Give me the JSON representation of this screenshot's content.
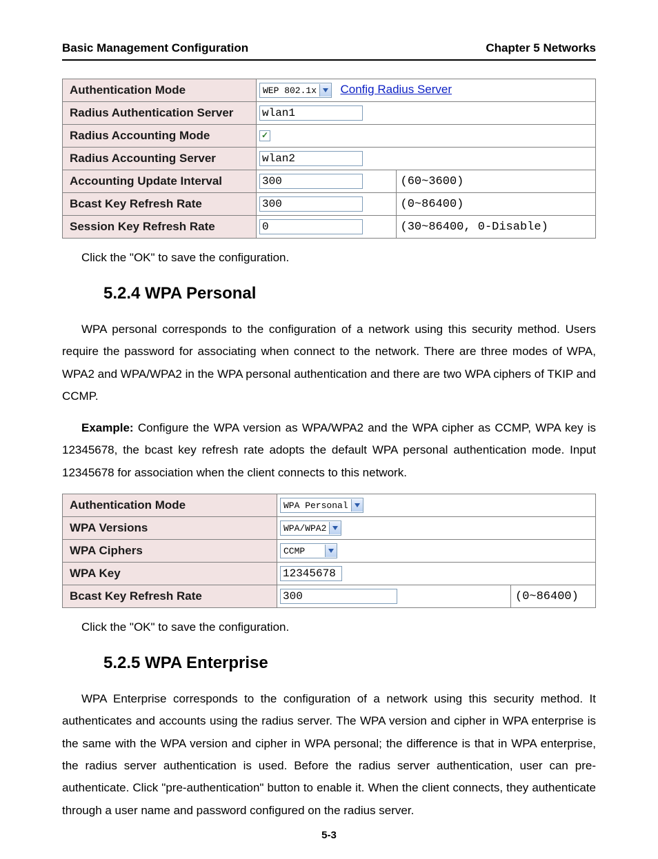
{
  "header": {
    "left": "Basic Management Configuration",
    "right": "Chapter 5 Networks"
  },
  "table1": {
    "rows": [
      {
        "label": "Authentication Mode",
        "select": "WEP 802.1x",
        "select_width": 90,
        "link": "Config Radius Server"
      },
      {
        "label": "Radius Authentication Server",
        "input": "wlan1",
        "input_width": 150
      },
      {
        "label": "Radius Accounting Mode",
        "checkbox": true
      },
      {
        "label": "Radius Accounting Server",
        "input": "wlan2",
        "input_width": 150
      },
      {
        "label": "Accounting Update Interval",
        "input": "300",
        "input_width": 150,
        "hint": "(60~3600)"
      },
      {
        "label": "Bcast Key Refresh Rate",
        "input": "300",
        "input_width": 150,
        "hint": "(0~86400)"
      },
      {
        "label": "Session Key Refresh Rate",
        "input": "0",
        "input_width": 150,
        "hint": "(30~86400, 0-Disable)"
      }
    ]
  },
  "save1": "Click the \"OK\" to save the configuration.",
  "heading1": "5.2.4 WPA Personal",
  "para1": "WPA personal corresponds to the configuration of a network using this security method. Users require the password for associating when connect to the network. There are three modes of WPA, WPA2 and WPA/WPA2 in the WPA personal authentication and there are two WPA ciphers of TKIP and CCMP.",
  "para2_lead": "Example: ",
  "para2_body": "Configure the WPA version as WPA/WPA2 and the WPA cipher as CCMP, WPA key is 12345678, the bcast key refresh rate adopts the default WPA personal authentication mode. Input 12345678 for association when the client connects to this network.",
  "table2": {
    "rows": [
      {
        "label": "Authentication Mode",
        "select": "WPA Personal",
        "select_width": 110
      },
      {
        "label": "WPA Versions",
        "select": "WPA/WPA2",
        "select_width": 70
      },
      {
        "label": "WPA Ciphers",
        "select": "CCMP",
        "select_width": 80
      },
      {
        "label": "WPA Key",
        "input": "12345678",
        "input_width": 90
      },
      {
        "label": "Bcast Key Refresh Rate",
        "input": "300",
        "input_width": 170,
        "hint": "(0~86400)"
      }
    ]
  },
  "save2": "Click the \"OK\" to save the configuration.",
  "heading2": "5.2.5 WPA Enterprise",
  "para3": "WPA Enterprise corresponds to the configuration of a network using this security method. It authenticates and accounts using the radius server. The WPA version and cipher in WPA enterprise is the same with the WPA version and cipher in WPA personal; the difference is that in WPA enterprise, the radius server authentication is used. Before the radius server authentication, user can pre-authenticate. Click \"pre-authentication\" button to enable it. When the client connects, they authenticate through a user name and password configured on the radius server.",
  "pagenum": "5-3"
}
